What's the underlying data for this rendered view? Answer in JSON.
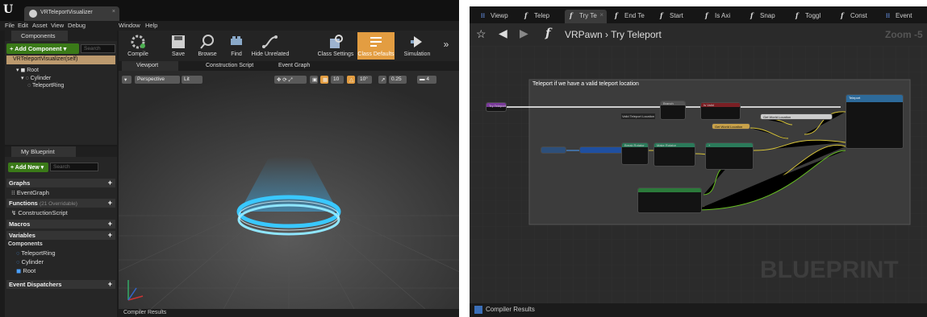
{
  "left_editor": {
    "doc_tab": "VRTeleportVisualizer",
    "menu": [
      "File",
      "Edit",
      "Asset",
      "View",
      "Debug",
      "Window",
      "Help"
    ],
    "components_panel": {
      "title": "Components",
      "add_button": "+ Add Component ▾",
      "search_placeholder": "Search",
      "self_item": "VRTeleportVisualizer(self)",
      "tree": [
        "Root",
        "Cylinder",
        "TeleportRing"
      ]
    },
    "toolbar": [
      "Compile",
      "Save",
      "Browse",
      "Find",
      "Hide Unrelated",
      "Class Settings",
      "Class Defaults",
      "Simulation"
    ],
    "viewport_tabs": [
      "Viewport",
      "Construction Script",
      "Event Graph"
    ],
    "viewport_controls": {
      "perspective": "Perspective",
      "lit": "Lit",
      "grid_snap": "10",
      "rot_snap": "10°",
      "scale_snap": "0.25",
      "cam_speed": "4"
    },
    "my_blueprint": {
      "title": "My Blueprint",
      "add_new": "+ Add New ▾",
      "search_placeholder": "Search",
      "graphs_label": "Graphs",
      "event_graph": "EventGraph",
      "functions_label": "Functions",
      "functions_sub": "(21 Overridable)",
      "construction_script": "ConstructionScript",
      "macros_label": "Macros",
      "variables_label": "Variables",
      "components_label": "Components",
      "components": [
        "TeleportRing",
        "Cylinder",
        "Root"
      ],
      "dispatchers_label": "Event Dispatchers"
    },
    "bottom_tab": "Compiler Results"
  },
  "right_editor": {
    "tabs": [
      "Viewp",
      "Telep",
      "Try Te",
      "End Te",
      "Start",
      "Is Axi",
      "Snap",
      "Toggl",
      "Const",
      "Event"
    ],
    "breadcrumb": {
      "parent": "VRPawn",
      "current": "Try Teleport"
    },
    "zoom": "Zoom -5",
    "comment": "Teleport if we have a valid teleport location",
    "nodes": {
      "entry": "Try Teleport",
      "branch": "Branch",
      "ret": "Return",
      "valid": "Valid Teleport Location",
      "is_valid": "Is Valid",
      "get_loc": "Get World Location",
      "make_rot": "Make Rotator",
      "break_rot": "Break Rotator",
      "add": "+",
      "teleport": "Teleport"
    },
    "watermark": "BLUEPRINT",
    "bottom_tab": "Compiler Results"
  },
  "colors": {
    "accent_orange": "#e39d41",
    "add_green": "#3a7a18",
    "self_highlight": "#bc9a6e",
    "ring_cyan": "#38c8ff",
    "func_node_blue": "#2d6a9a",
    "exec_white": "#ffffff",
    "wire_yellow": "#d8c53a",
    "wire_green": "#67c020"
  }
}
